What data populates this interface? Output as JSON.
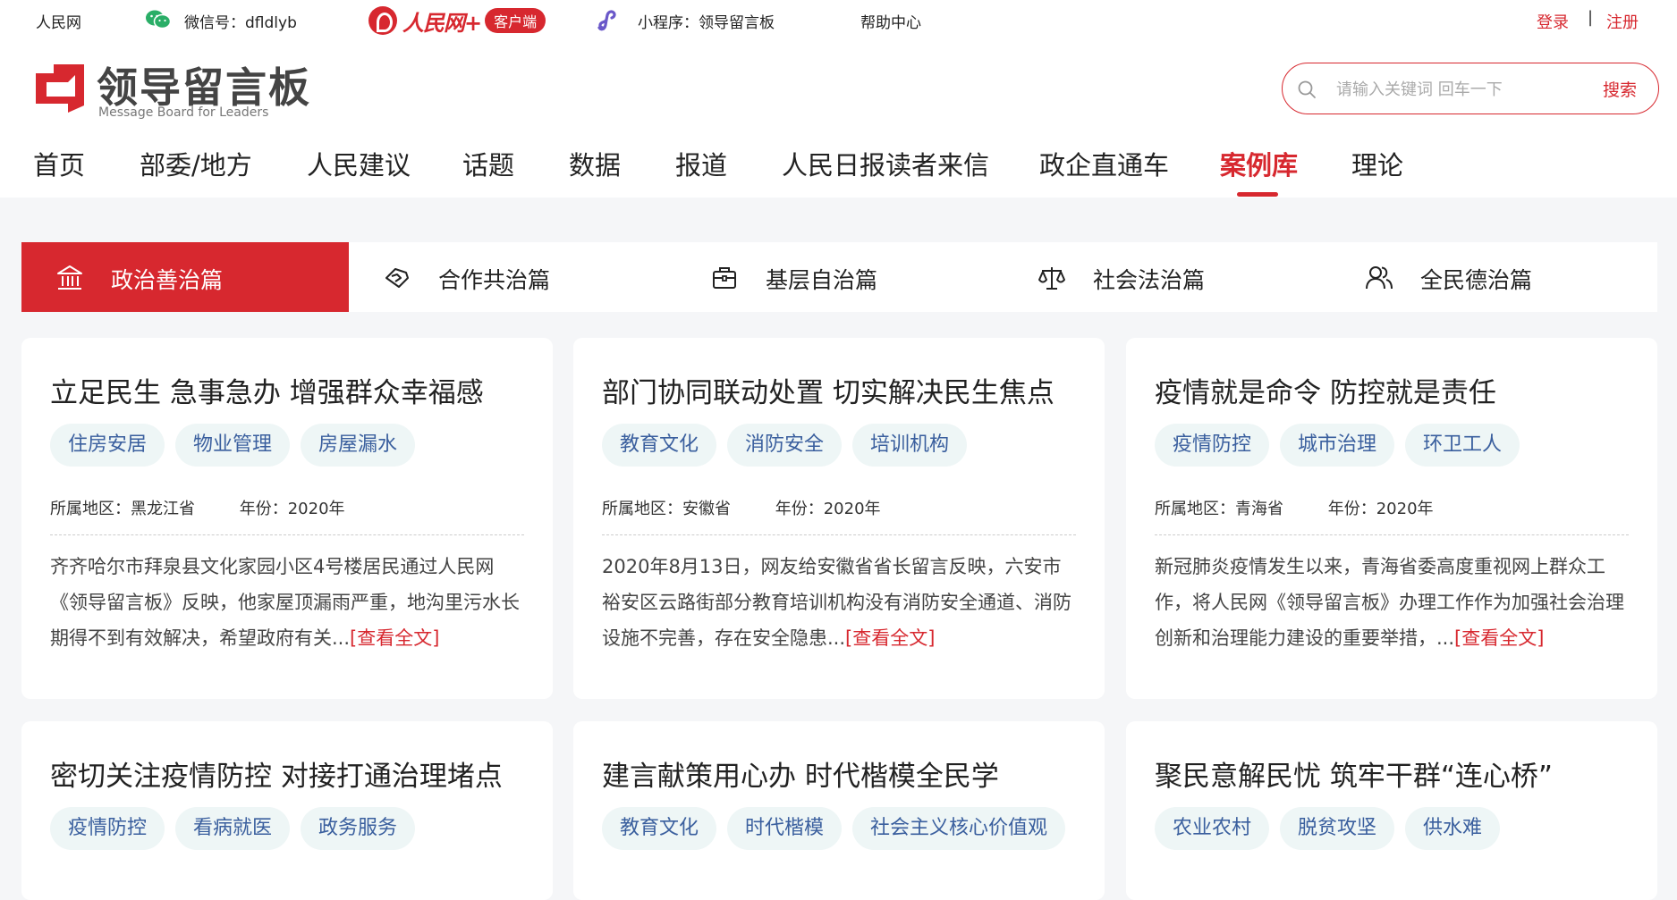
{
  "topbar": {
    "site": "人民网",
    "wechat": "微信号：dfldlyb",
    "app_brand": "人民网+",
    "app_badge": "客户端",
    "miniprogram": "小程序：领导留言板",
    "help": "帮助中心",
    "login": "登录",
    "separator": "|",
    "register": "注册"
  },
  "logo": {
    "title": "领导留言板",
    "subtitle": "Message Board for Leaders"
  },
  "search": {
    "placeholder": "请输入关键词 回车一下",
    "button": "搜索"
  },
  "nav": {
    "items": [
      "首页",
      "部委/地方",
      "人民建议",
      "话题",
      "数据",
      "报道",
      "人民日报读者来信",
      "政企直通车",
      "案例库",
      "理论"
    ],
    "active": "案例库"
  },
  "categories": [
    {
      "label": "政治善治篇",
      "icon": "government-building-icon",
      "active": true
    },
    {
      "label": "合作共治篇",
      "icon": "handshake-icon",
      "active": false
    },
    {
      "label": "基层自治篇",
      "icon": "briefcase-icon",
      "active": false
    },
    {
      "label": "社会法治篇",
      "icon": "scales-icon",
      "active": false
    },
    {
      "label": "全民德治篇",
      "icon": "people-icon",
      "active": false
    }
  ],
  "cards": [
    {
      "title": "立足民生 急事急办 增强群众幸福感",
      "tags": [
        "住房安居",
        "物业管理",
        "房屋漏水"
      ],
      "region_label": "所属地区：",
      "region": "黑龙江省",
      "year_label": "年份：",
      "year": "2020年",
      "desc": "齐齐哈尔市拜泉县文化家园小区4号楼居民通过人民网《领导留言板》反映，他家屋顶漏雨严重，地沟里污水长期得不到有效解决，希望政府有关...",
      "more": "[查看全文]"
    },
    {
      "title": "部门协同联动处置 切实解决民生焦点",
      "tags": [
        "教育文化",
        "消防安全",
        "培训机构"
      ],
      "region_label": "所属地区：",
      "region": "安徽省",
      "year_label": "年份：",
      "year": "2020年",
      "desc": "2020年8月13日，网友给安徽省省长留言反映，六安市裕安区云路街部分教育培训机构没有消防安全通道、消防设施不完善，存在安全隐患...",
      "more": "[查看全文]"
    },
    {
      "title": "疫情就是命令 防控就是责任",
      "tags": [
        "疫情防控",
        "城市治理",
        "环卫工人"
      ],
      "region_label": "所属地区：",
      "region": "青海省",
      "year_label": "年份：",
      "year": "2020年",
      "desc": "新冠肺炎疫情发生以来，青海省委高度重视网上群众工作，将人民网《领导留言板》办理工作作为加强社会治理创新和治理能力建设的重要举措，...",
      "more": "[查看全文]"
    },
    {
      "title": "密切关注疫情防控 对接打通治理堵点",
      "tags": [
        "疫情防控",
        "看病就医",
        "政务服务"
      ]
    },
    {
      "title": "建言献策用心办 时代楷模全民学",
      "tags": [
        "教育文化",
        "时代楷模",
        "社会主义核心价值观"
      ]
    },
    {
      "title": "聚民意解民忧 筑牢干群“连心桥”",
      "tags": [
        "农业农村",
        "脱贫攻坚",
        "供水难"
      ]
    }
  ],
  "colors": {
    "brand_red": "#d7282f",
    "tag_bg": "#eef6f6",
    "tag_text": "#3a5f9e",
    "page_bg": "#f5f6f8"
  }
}
